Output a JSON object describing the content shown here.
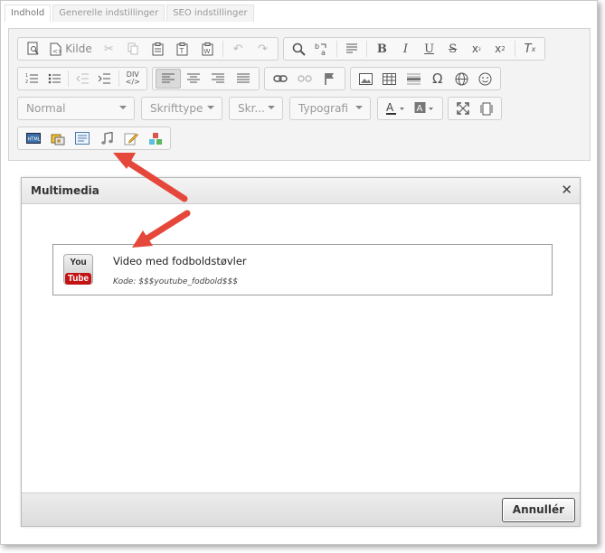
{
  "tabs": [
    {
      "label": "Indhold"
    },
    {
      "label": "Generelle indstillinger"
    },
    {
      "label": "SEO indstillinger"
    }
  ],
  "toolbar": {
    "source_label": "Kilde",
    "div_label": "DIV",
    "combos": {
      "format": "Normal",
      "font": "Skrifttype",
      "size": "Skr...",
      "typography": "Typografi"
    }
  },
  "dialog": {
    "title": "Multimedia",
    "cancel_label": "Annullér",
    "items": [
      {
        "logo_top": "You",
        "logo_bottom": "Tube",
        "title": "Video med fodboldstøvler",
        "code": "Kode: $$$youtube_fodbold$$$"
      }
    ]
  },
  "colors": {
    "arrow": "#e5473a",
    "youtube_red": "#c21414"
  }
}
